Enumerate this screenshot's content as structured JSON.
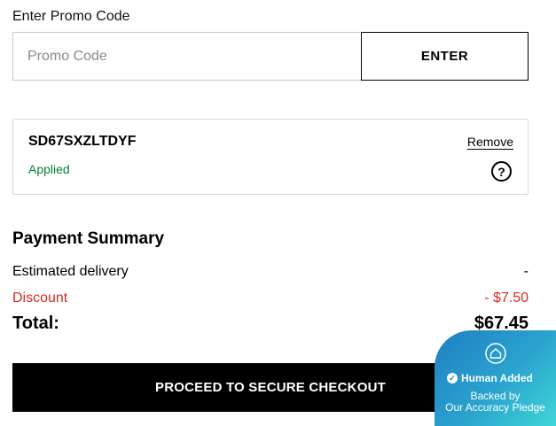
{
  "promo": {
    "label": "Enter Promo Code",
    "placeholder": "Promo Code",
    "enter_label": "ENTER"
  },
  "applied": {
    "code": "SD67SXZLTDYF",
    "status": "Applied",
    "remove_label": "Remove",
    "help_glyph": "?"
  },
  "summary": {
    "title": "Payment Summary",
    "delivery_label": "Estimated delivery",
    "delivery_value": "-",
    "discount_label": "Discount",
    "discount_value": "- $7.50",
    "total_label": "Total:",
    "total_value": "$67.45"
  },
  "checkout_label": "PROCEED TO SECURE CHECKOUT",
  "badge": {
    "title": "Human Added",
    "line1": "Backed by",
    "line2": "Our Accuracy Pledge"
  },
  "colors": {
    "applied_green": "#008331",
    "discount_red": "#d52b1e",
    "checkout_bg": "#000000"
  }
}
